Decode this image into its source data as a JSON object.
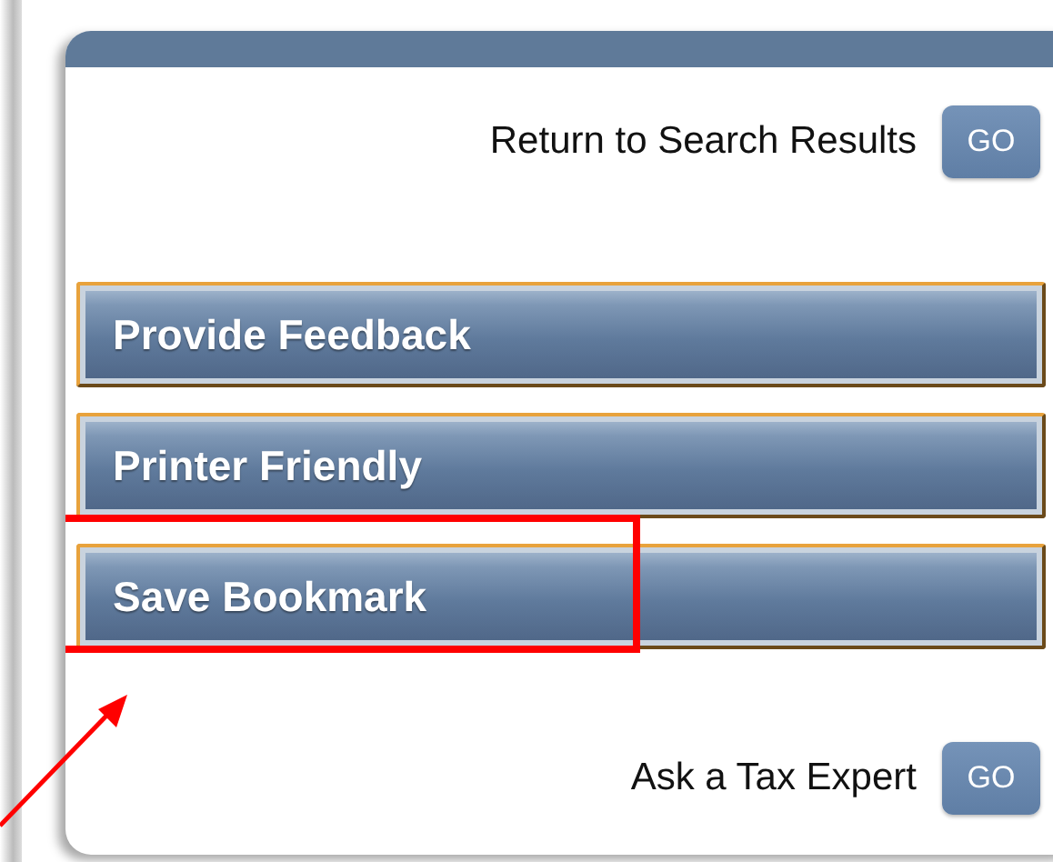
{
  "top_link": {
    "label": "Return to Search Results",
    "button": "GO"
  },
  "menu_buttons": [
    {
      "label": "Provide Feedback",
      "highlighted": false
    },
    {
      "label": "Printer Friendly",
      "highlighted": false
    },
    {
      "label": "Save Bookmark",
      "highlighted": true
    }
  ],
  "bottom_link": {
    "label": "Ask a Tax Expert",
    "button": "GO"
  }
}
